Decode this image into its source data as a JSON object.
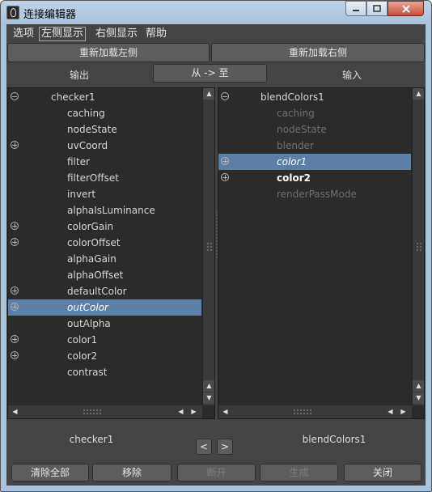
{
  "window": {
    "title": "连接编辑器"
  },
  "menubar": [
    "选项",
    "左侧显示",
    "右侧显示",
    "帮助"
  ],
  "reload_left": "重新加载左侧",
  "reload_right": "重新加载右侧",
  "output_label": "输出",
  "from_to_button": "从 -> 至",
  "input_label": "输入",
  "left_panel": {
    "node": "checker1",
    "attributes": [
      {
        "label": "caching",
        "expandable": false
      },
      {
        "label": "nodeState",
        "expandable": false
      },
      {
        "label": "uvCoord",
        "expandable": true
      },
      {
        "label": "filter",
        "expandable": false
      },
      {
        "label": "filterOffset",
        "expandable": false
      },
      {
        "label": "invert",
        "expandable": false
      },
      {
        "label": "alphaIsLuminance",
        "expandable": false
      },
      {
        "label": "colorGain",
        "expandable": true
      },
      {
        "label": "colorOffset",
        "expandable": true
      },
      {
        "label": "alphaGain",
        "expandable": false
      },
      {
        "label": "alphaOffset",
        "expandable": false
      },
      {
        "label": "defaultColor",
        "expandable": true
      },
      {
        "label": "outColor",
        "expandable": true,
        "selected": true
      },
      {
        "label": "outAlpha",
        "expandable": false
      },
      {
        "label": "color1",
        "expandable": true
      },
      {
        "label": "color2",
        "expandable": true
      },
      {
        "label": "contrast",
        "expandable": false
      }
    ]
  },
  "right_panel": {
    "node": "blendColors1",
    "attributes": [
      {
        "label": "caching",
        "expandable": false,
        "dimmed": true
      },
      {
        "label": "nodeState",
        "expandable": false,
        "dimmed": true
      },
      {
        "label": "blender",
        "expandable": false,
        "dimmed": true
      },
      {
        "label": "color1",
        "expandable": true,
        "selected": true,
        "connected": true
      },
      {
        "label": "color2",
        "expandable": true,
        "bold": true
      },
      {
        "label": "renderPassMode",
        "expandable": false,
        "dimmed": true
      }
    ]
  },
  "footer": {
    "left_node": "checker1",
    "right_node": "blendColors1",
    "prev_arrow": "<",
    "next_arrow": ">"
  },
  "buttons": {
    "clear_all": "清除全部",
    "remove": "移除",
    "break": "断开",
    "make": "生成",
    "close": "关闭"
  },
  "colors": {
    "selection": "#5b7fa6",
    "panel_bg": "#2b2b2b",
    "window_bg": "#444444"
  }
}
